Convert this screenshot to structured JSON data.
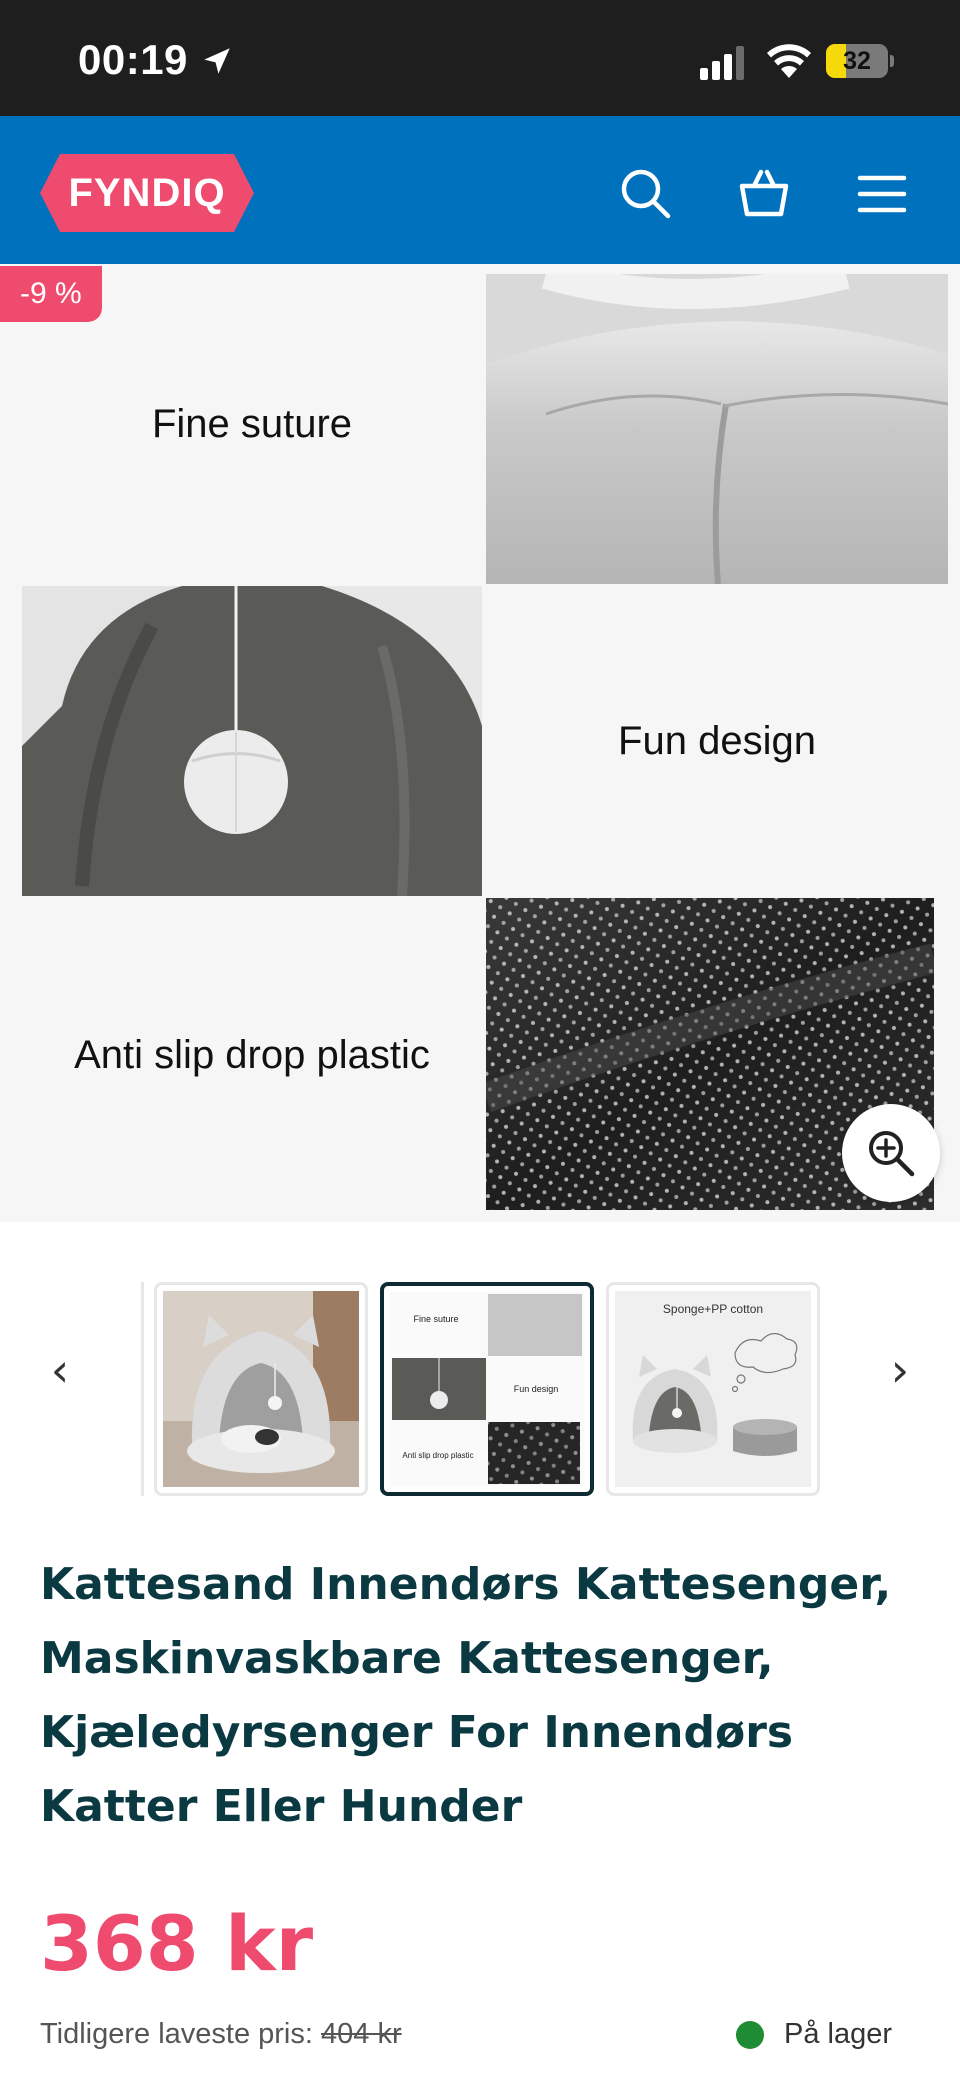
{
  "status_bar": {
    "time": "00:19",
    "battery_level": "32",
    "battery_fraction": 0.32
  },
  "header": {
    "logo_text": "FYNDIQ",
    "colors": {
      "header_bg": "#0071bc",
      "logo_bg": "#ef4b6f"
    },
    "icons": [
      "search-icon",
      "basket-icon",
      "menu-icon"
    ]
  },
  "product_image": {
    "discount_badge": "-9 %",
    "captions": {
      "suture": "Fine suture",
      "design": "Fun design",
      "antislip": "Anti slip drop plastic"
    }
  },
  "thumbnails": {
    "prev_arrow": "‹",
    "next_arrow": "›",
    "items": [
      {
        "kind": "photo-cat-bed"
      },
      {
        "kind": "collage",
        "captions": [
          "Fine suture",
          "Fun design",
          "Anti slip drop plastic"
        ],
        "selected": true
      },
      {
        "kind": "materials",
        "caption": "Sponge+PP cotton"
      }
    ]
  },
  "product": {
    "title": "Kattesand Innendørs Kattesenger, Maskinvaskbare Kattesenger, Kjæle­dyrsenger For Innendørs Katter Eller Hunder",
    "price": "368 kr",
    "previous_label": "Tidligere laveste pris:",
    "previous_price": "404 kr",
    "stock_status": "På lager"
  },
  "colors": {
    "accent": "#ef4b6f",
    "title": "#0b3942",
    "in_stock": "#1e8c32"
  }
}
